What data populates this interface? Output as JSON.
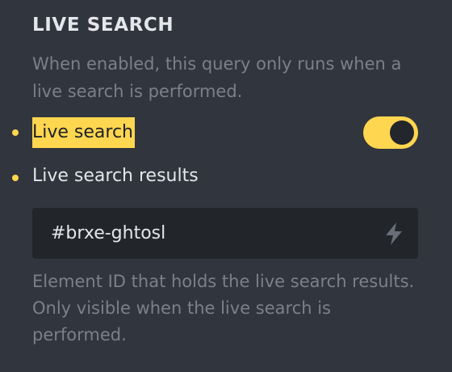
{
  "section": {
    "title": "LIVE SEARCH",
    "description": "When enabled, this query only runs when a live search is performed."
  },
  "live_search": {
    "label": "Live search",
    "enabled": true
  },
  "live_search_results": {
    "label": "Live search results",
    "value": "#brxe-ghtosl",
    "icon": "bolt-icon",
    "description": "Element ID that holds the live search results. Only visible when the live search is performed."
  },
  "colors": {
    "background": "#31353d",
    "accent": "#ffd64f",
    "input_background": "#22252a",
    "muted_text": "#7b8089",
    "text": "#e4e6ea"
  }
}
